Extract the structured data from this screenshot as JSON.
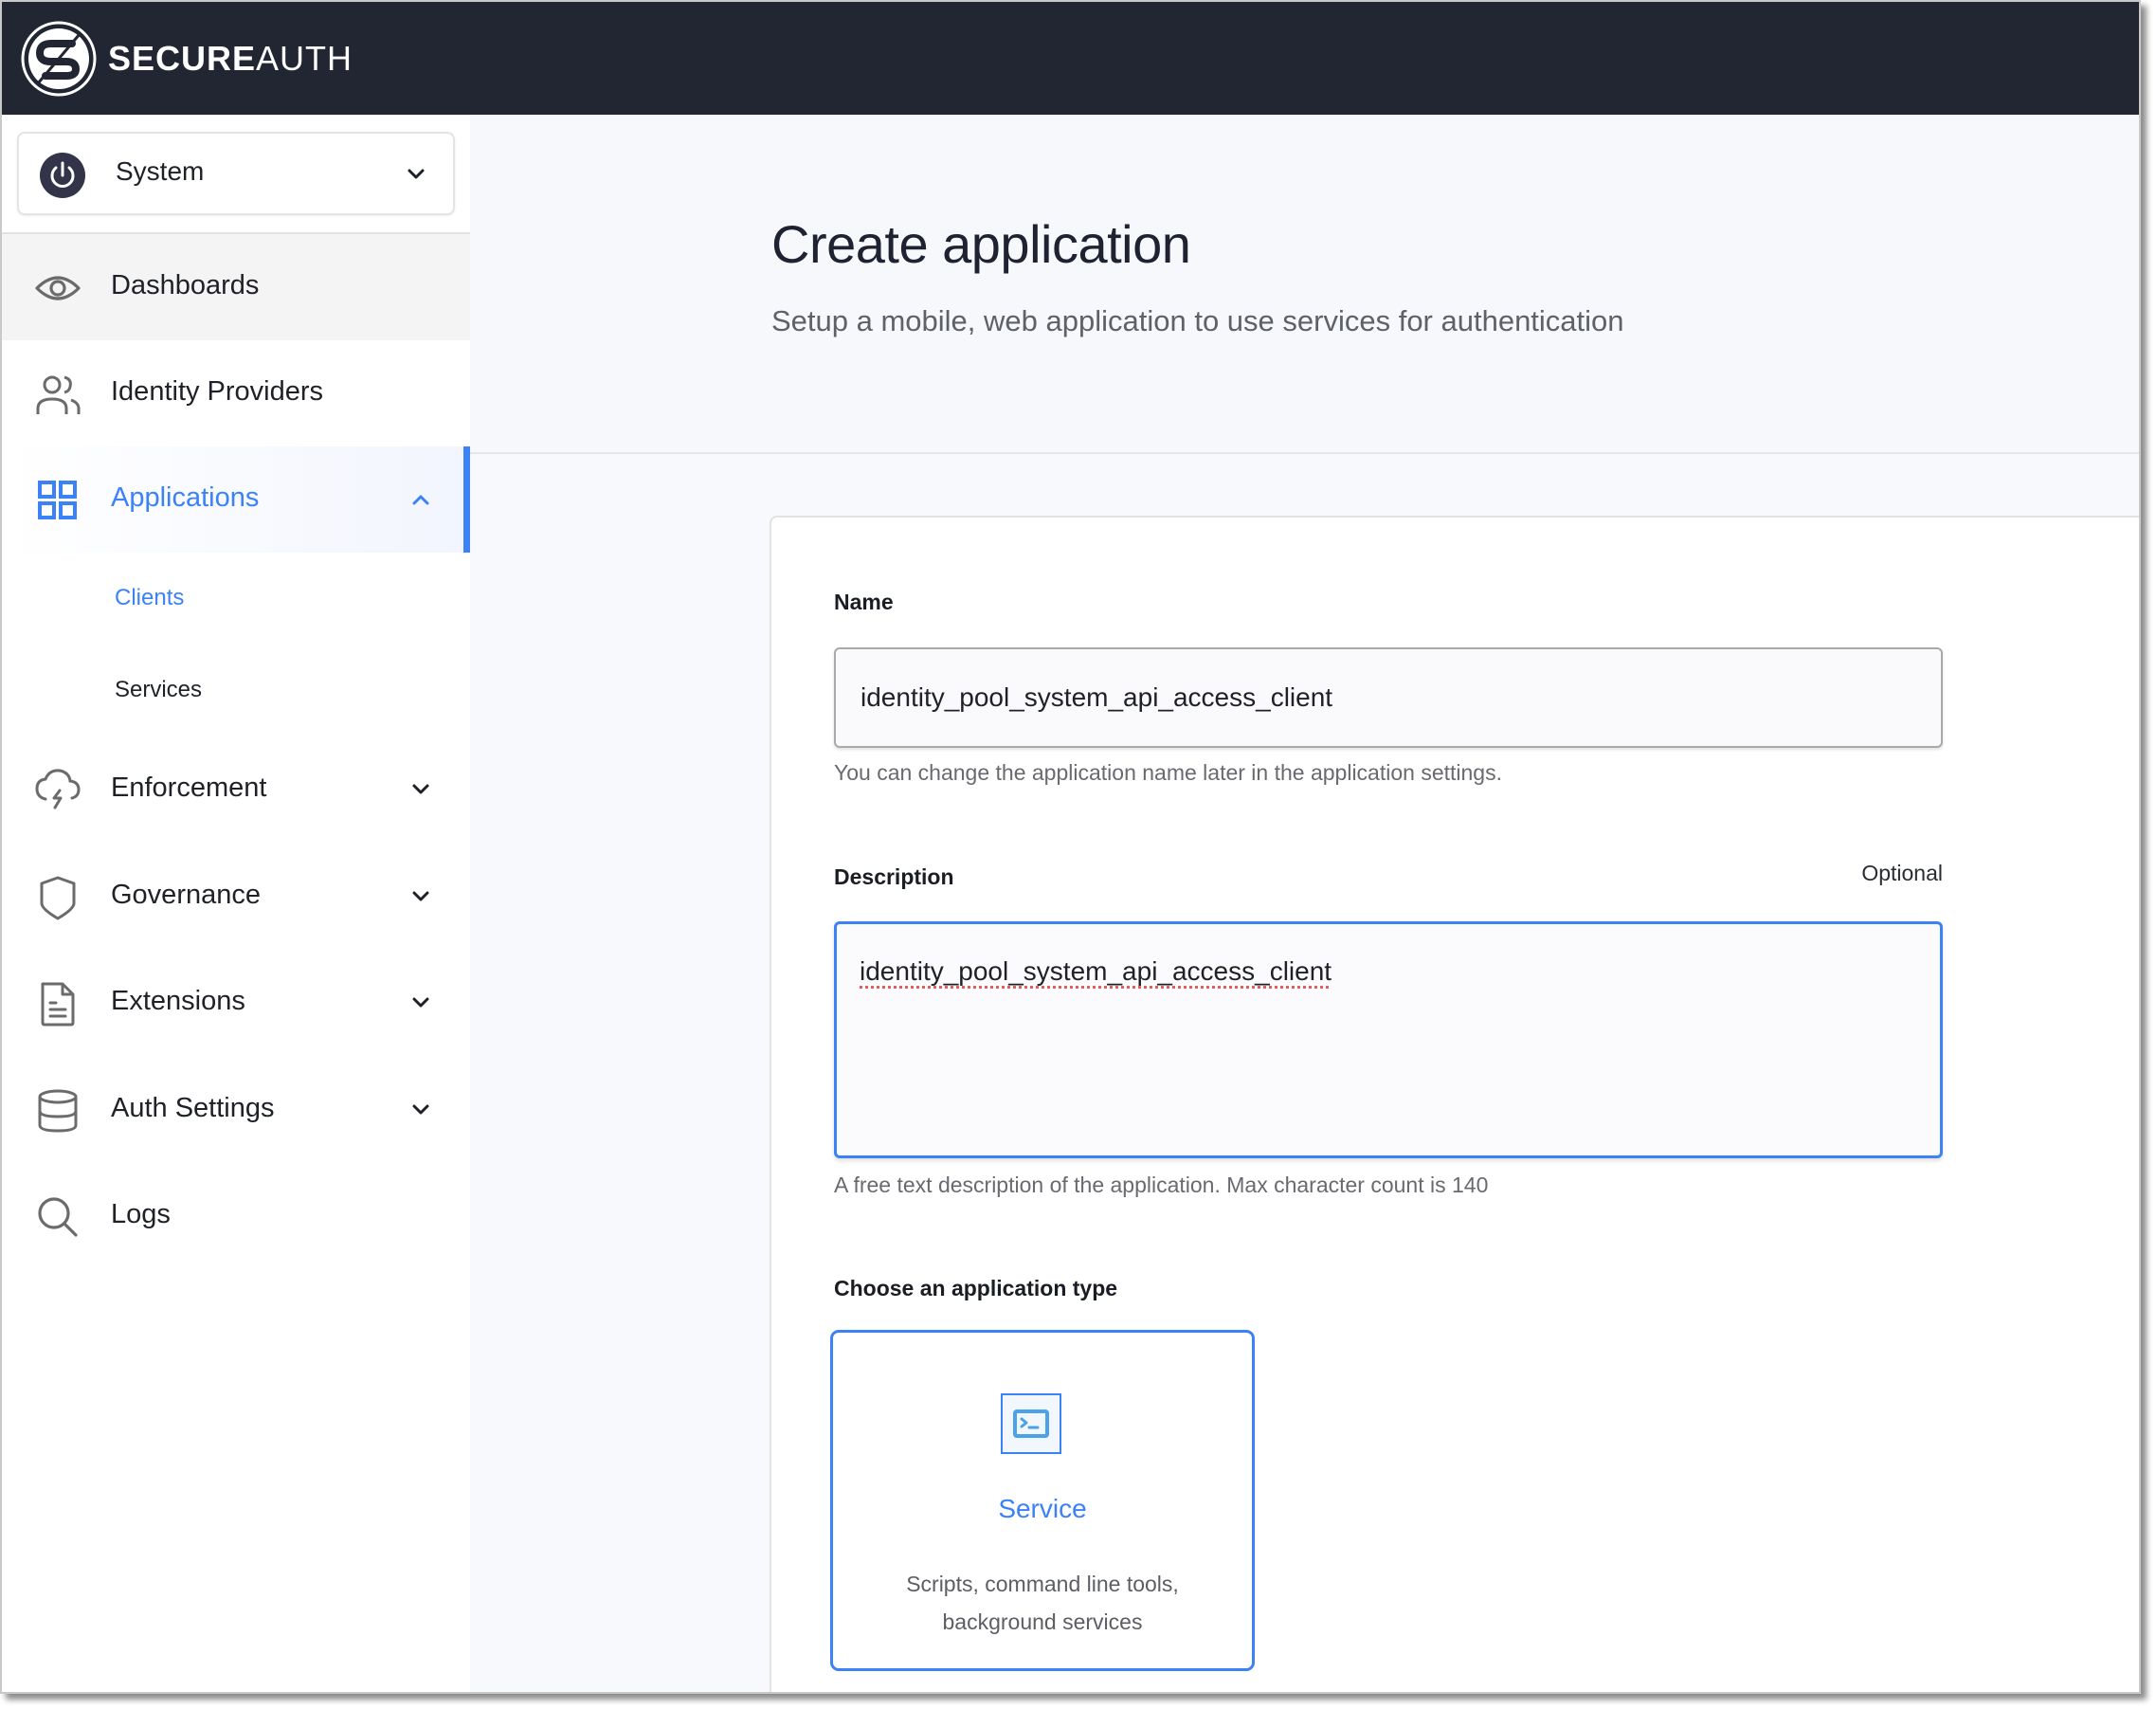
{
  "app": {
    "brand_bold": "SECURE",
    "brand_light": "AUTH"
  },
  "sidebar": {
    "environment": {
      "label": "System",
      "icon": "power-icon"
    },
    "items": [
      {
        "label": "Dashboards",
        "icon": "eye-icon",
        "state": "hover"
      },
      {
        "label": "Identity Providers",
        "icon": "users-icon"
      },
      {
        "label": "Applications",
        "icon": "grid-icon",
        "state": "active",
        "expanded": true,
        "children": [
          {
            "label": "Clients",
            "active": true
          },
          {
            "label": "Services"
          }
        ]
      },
      {
        "label": "Enforcement",
        "icon": "cloud-lightning-icon",
        "expandable": true
      },
      {
        "label": "Governance",
        "icon": "shield-icon",
        "expandable": true
      },
      {
        "label": "Extensions",
        "icon": "document-icon",
        "expandable": true
      },
      {
        "label": "Auth Settings",
        "icon": "database-icon",
        "expandable": true
      },
      {
        "label": "Logs",
        "icon": "search-icon"
      }
    ]
  },
  "page": {
    "title": "Create application",
    "subtitle": "Setup a mobile, web application to use services for authentication"
  },
  "form": {
    "name": {
      "label": "Name",
      "value": "identity_pool_system_api_access_client",
      "helper": "You can change the application name later in the application settings."
    },
    "description": {
      "label": "Description",
      "optional": "Optional",
      "value": "identity_pool_system_api_access_client",
      "helper": "A free text description of the application. Max character count is 140"
    },
    "app_type": {
      "label": "Choose an application type",
      "options": [
        {
          "title": "Service",
          "icon": "terminal-icon",
          "description": "Scripts, command line tools, background services",
          "selected": true
        }
      ]
    }
  },
  "colors": {
    "header_bg": "#222633",
    "accent": "#3b82f6",
    "page_bg": "#f8f9fc"
  }
}
